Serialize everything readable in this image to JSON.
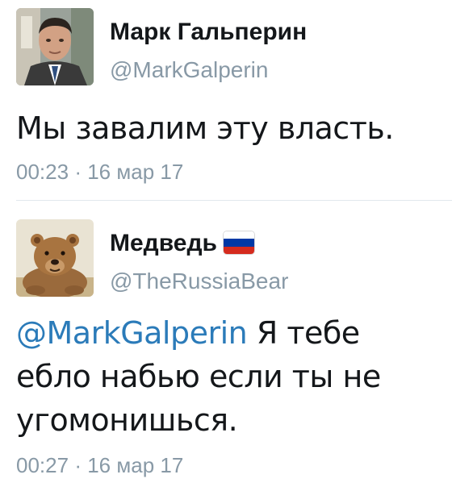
{
  "tweets": [
    {
      "name": "Марк Гальперин",
      "handle": "@MarkGalperin",
      "text": "Мы завалим эту власть.",
      "time": "00:23",
      "separator": "·",
      "date": "16 мар 17"
    },
    {
      "name": "Медведь",
      "handle": "@TheRussiaBear",
      "mention": "@MarkGalperin",
      "text": " Я тебе ебло набью если ты не угомонишься.",
      "time": "00:27",
      "separator": "·",
      "date": "16 мар 17",
      "flag_colors": [
        "#ffffff",
        "#0039a6",
        "#d52b1e"
      ]
    }
  ],
  "colors": {
    "text": "#14171a",
    "secondary": "#8899a6",
    "link": "#2b7bb9",
    "divider": "#e1e8ed"
  }
}
